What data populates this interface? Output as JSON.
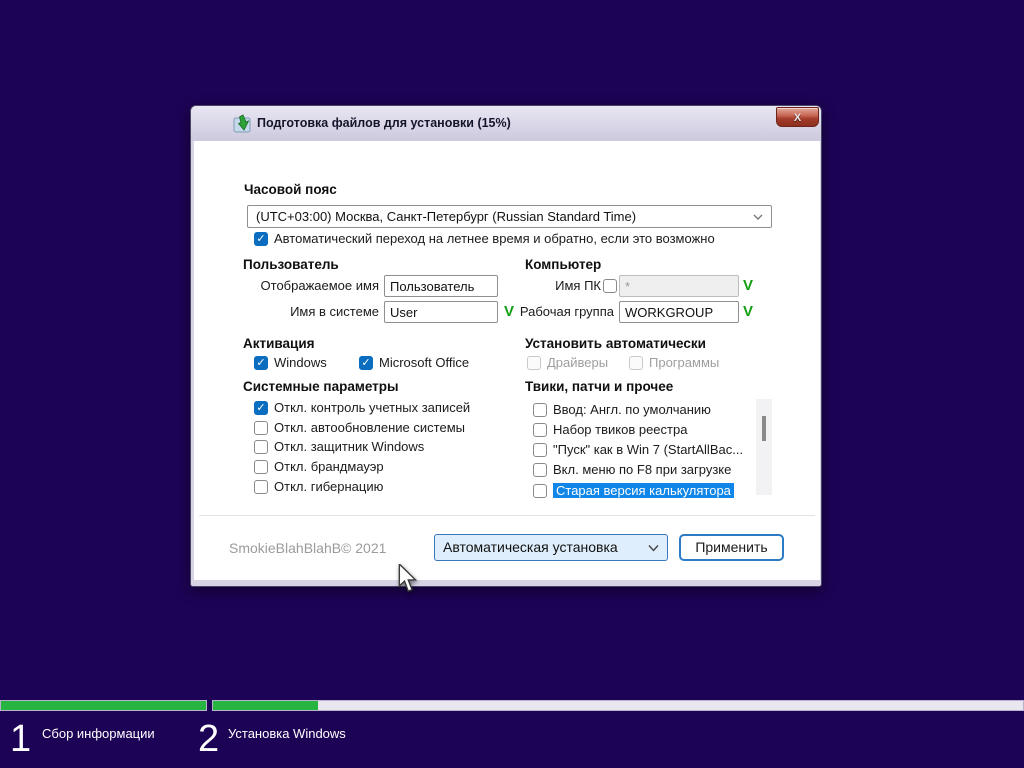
{
  "window": {
    "title": "Подготовка файлов для установки (15%)",
    "close_label": "X",
    "icon": "green-install-arrow-icon"
  },
  "timezone": {
    "header": "Часовой пояс",
    "selected": "(UTC+03:00) Москва, Санкт-Петербург (Russian Standard Time)",
    "dst_checkbox": {
      "label": "Автоматический переход на летнее время и обратно, если это возможно",
      "checked": true
    }
  },
  "user": {
    "header": "Пользователь",
    "display_name": {
      "label": "Отображаемое имя",
      "value": "Пользователь"
    },
    "system_name": {
      "label": "Имя в системе",
      "value": "User",
      "status": "V"
    }
  },
  "computer": {
    "header": "Компьютер",
    "pc_name": {
      "label": "Имя ПК",
      "checked": false,
      "value": "*",
      "status": "V"
    },
    "workgroup": {
      "label": "Рабочая группа",
      "value": "WORKGROUP",
      "status": "V"
    }
  },
  "activation": {
    "header": "Активация",
    "items": [
      {
        "label": "Windows",
        "checked": true
      },
      {
        "label": "Microsoft Office",
        "checked": true
      }
    ]
  },
  "auto_install": {
    "header": "Установить автоматически",
    "items": [
      {
        "label": "Драйверы",
        "checked": false,
        "disabled": true
      },
      {
        "label": "Программы",
        "checked": false,
        "disabled": true
      }
    ]
  },
  "system_params": {
    "header": "Системные параметры",
    "items": [
      {
        "label": "Откл. контроль учетных записей",
        "checked": true
      },
      {
        "label": "Откл. автообновление системы",
        "checked": false
      },
      {
        "label": "Откл. защитник Windows",
        "checked": false
      },
      {
        "label": "Откл. брандмауэр",
        "checked": false
      },
      {
        "label": "Откл. гибернацию",
        "checked": false
      }
    ]
  },
  "tweaks": {
    "header": "Твики, патчи и прочее",
    "items": [
      {
        "label": "Ввод: Англ. по умолчанию",
        "checked": false
      },
      {
        "label": "Набор твиков реестра",
        "checked": false
      },
      {
        "label": "\"Пуск\" как в Win 7 (StartAllBac...",
        "checked": false
      },
      {
        "label": "Вкл. меню по F8 при загрузке",
        "checked": false
      },
      {
        "label": "Старая версия калькулятора",
        "checked": false,
        "selected": true
      }
    ]
  },
  "footer": {
    "copyright": "SmokieBlahBlahB© 2021",
    "mode_select": "Автоматическая установка",
    "apply_button": "Применить"
  },
  "setup_steps": {
    "steps": [
      {
        "number": "1",
        "label": "Сбор информации",
        "progress_percent": 100
      },
      {
        "number": "2",
        "label": "Установка Windows",
        "progress_percent": 13
      }
    ]
  },
  "colors": {
    "desktop_background": "#1d0355",
    "progress_green": "#27b440",
    "checkbox_accent": "#0b6dc0",
    "selection_highlight": "#1086e8",
    "status_ok_green": "#12a012"
  }
}
